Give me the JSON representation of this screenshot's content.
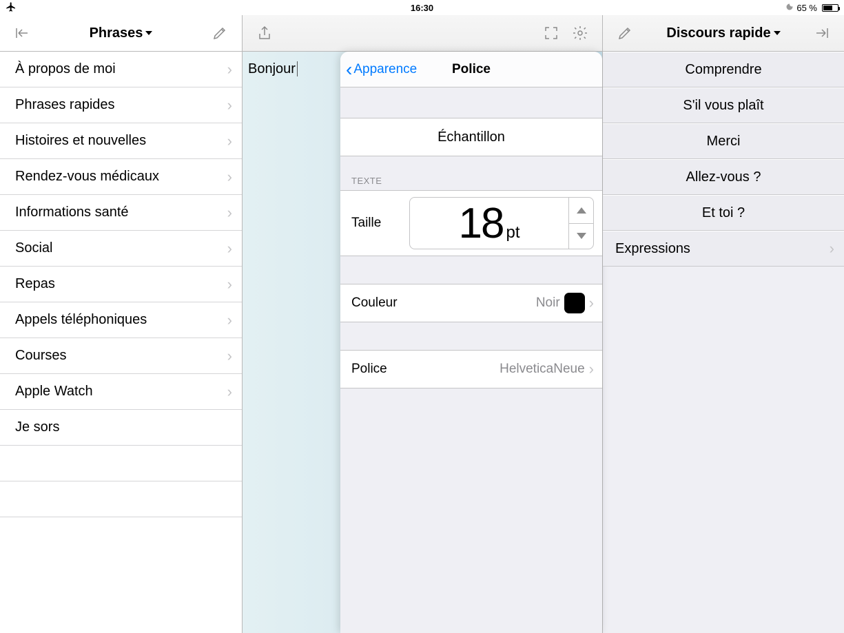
{
  "statusbar": {
    "time": "16:30",
    "battery_pct": "65 %"
  },
  "left": {
    "title": "Phrases",
    "items": [
      "À propos de moi",
      "Phrases rapides",
      "Histoires et nouvelles",
      "Rendez-vous médicaux",
      "Informations santé",
      "Social",
      "Repas",
      "Appels téléphoniques",
      "Courses",
      "Apple Watch",
      "Je sors"
    ]
  },
  "mid": {
    "text": "Bonjour"
  },
  "right": {
    "title": "Discours rapide",
    "items": [
      "Comprendre",
      "S'il vous plaît",
      "Merci",
      "Allez-vous ?",
      "Et toi ?",
      "Expressions"
    ]
  },
  "popover": {
    "back": "Apparence",
    "title": "Police",
    "sample": "Échantillon",
    "section_label": "TEXTE",
    "size_label": "Taille",
    "size_value": "18",
    "size_unit": "pt",
    "color_label": "Couleur",
    "color_value": "Noir",
    "font_label": "Police",
    "font_value": "HelveticaNeue"
  }
}
